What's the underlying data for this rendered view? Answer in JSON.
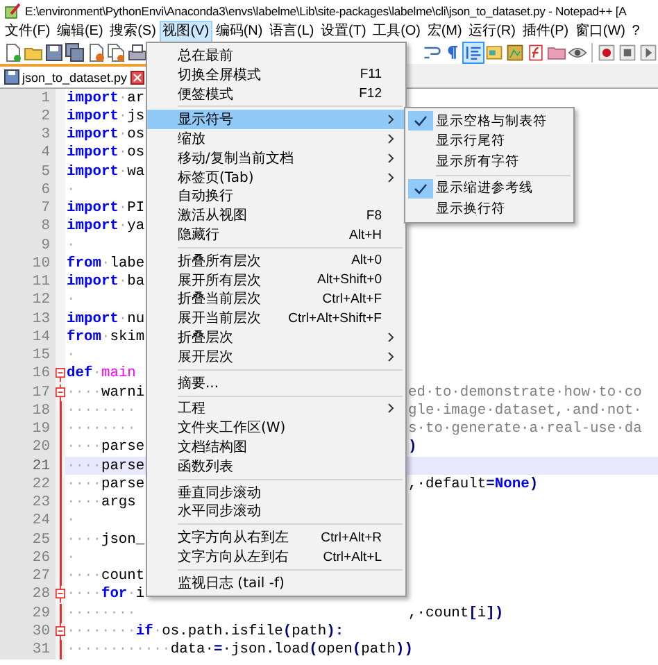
{
  "window": {
    "title": "E:\\environment\\PythonEnvi\\Anaconda3\\envs\\labelme\\Lib\\site-packages\\labelme\\cli\\json_to_dataset.py - Notepad++ [A"
  },
  "menubar": [
    {
      "label": "文件(F)",
      "selected": false
    },
    {
      "label": "编辑(E)",
      "selected": false
    },
    {
      "label": "搜索(S)",
      "selected": false
    },
    {
      "label": "视图(V)",
      "selected": true
    },
    {
      "label": "编码(N)",
      "selected": false
    },
    {
      "label": "语言(L)",
      "selected": false
    },
    {
      "label": "设置(T)",
      "selected": false
    },
    {
      "label": "工具(O)",
      "selected": false
    },
    {
      "label": "宏(M)",
      "selected": false
    },
    {
      "label": "运行(R)",
      "selected": false
    },
    {
      "label": "插件(P)",
      "selected": false
    },
    {
      "label": "窗口(W)",
      "selected": false
    },
    {
      "label": "?",
      "selected": false
    }
  ],
  "toolbar": {
    "left": [
      {
        "kind": "new"
      },
      {
        "kind": "open"
      },
      {
        "kind": "save"
      },
      {
        "kind": "save-all"
      },
      {
        "kind": "close"
      },
      {
        "kind": "close-all"
      },
      {
        "kind": "print"
      }
    ],
    "right": [
      {
        "kind": "wrap",
        "selected": false
      },
      {
        "kind": "pilcrow",
        "selected": false
      },
      {
        "kind": "indent",
        "selected": true
      },
      {
        "kind": "doc",
        "selected": false
      },
      {
        "kind": "map",
        "selected": false
      },
      {
        "kind": "func",
        "selected": false
      },
      {
        "kind": "folder",
        "selected": false
      },
      {
        "kind": "eye",
        "selected": false
      },
      {
        "kind": "sep",
        "selected": false
      },
      {
        "kind": "record",
        "selected": false
      },
      {
        "kind": "stop",
        "selected": false
      },
      {
        "kind": "play",
        "selected": false
      }
    ]
  },
  "tabs": [
    {
      "label": "json_to_dataset.py",
      "selected": true
    }
  ],
  "editor": {
    "lines": [
      {
        "number": "1",
        "fold_start": false,
        "in_fold": false,
        "highlighted": false,
        "left": [
          {
            "text": "import",
            "kind": "kw"
          },
          {
            "text": "·",
            "kind": "ws"
          },
          {
            "text": "ar",
            "kind": "tx"
          }
        ]
      },
      {
        "number": "2",
        "fold_start": false,
        "in_fold": false,
        "highlighted": false,
        "left": [
          {
            "text": "import",
            "kind": "kw"
          },
          {
            "text": "·",
            "kind": "ws"
          },
          {
            "text": "js",
            "kind": "tx"
          }
        ]
      },
      {
        "number": "3",
        "fold_start": false,
        "in_fold": false,
        "highlighted": false,
        "left": [
          {
            "text": "import",
            "kind": "kw"
          },
          {
            "text": "·",
            "kind": "ws"
          },
          {
            "text": "os",
            "kind": "tx"
          }
        ]
      },
      {
        "number": "4",
        "fold_start": false,
        "in_fold": false,
        "highlighted": false,
        "left": [
          {
            "text": "import",
            "kind": "kw"
          },
          {
            "text": "·",
            "kind": "ws"
          },
          {
            "text": "os",
            "kind": "tx"
          }
        ]
      },
      {
        "number": "5",
        "fold_start": false,
        "in_fold": false,
        "highlighted": false,
        "left": [
          {
            "text": "import",
            "kind": "kw"
          },
          {
            "text": "·",
            "kind": "ws"
          },
          {
            "text": "wa",
            "kind": "tx"
          }
        ]
      },
      {
        "number": "6",
        "fold_start": false,
        "in_fold": false,
        "highlighted": false,
        "left": [
          {
            "text": "·",
            "kind": "ws"
          }
        ]
      },
      {
        "number": "7",
        "fold_start": false,
        "in_fold": false,
        "highlighted": false,
        "left": [
          {
            "text": "import",
            "kind": "kw"
          },
          {
            "text": "·",
            "kind": "ws"
          },
          {
            "text": "PI",
            "kind": "tx"
          }
        ]
      },
      {
        "number": "8",
        "fold_start": false,
        "in_fold": false,
        "highlighted": false,
        "left": [
          {
            "text": "import",
            "kind": "kw"
          },
          {
            "text": "·",
            "kind": "ws"
          },
          {
            "text": "ya",
            "kind": "tx"
          }
        ]
      },
      {
        "number": "9",
        "fold_start": false,
        "in_fold": false,
        "highlighted": false,
        "left": [
          {
            "text": "·",
            "kind": "ws"
          }
        ]
      },
      {
        "number": "10",
        "fold_start": false,
        "in_fold": false,
        "highlighted": false,
        "left": [
          {
            "text": "from",
            "kind": "kw"
          },
          {
            "text": "·",
            "kind": "ws"
          },
          {
            "text": "labe",
            "kind": "tx"
          }
        ]
      },
      {
        "number": "11",
        "fold_start": false,
        "in_fold": false,
        "highlighted": false,
        "left": [
          {
            "text": "import",
            "kind": "kw"
          },
          {
            "text": "·",
            "kind": "ws"
          },
          {
            "text": "ba",
            "kind": "tx"
          }
        ]
      },
      {
        "number": "12",
        "fold_start": false,
        "in_fold": false,
        "highlighted": false,
        "left": [
          {
            "text": "·",
            "kind": "ws"
          }
        ]
      },
      {
        "number": "13",
        "fold_start": false,
        "in_fold": false,
        "highlighted": false,
        "left": [
          {
            "text": "import",
            "kind": "kw"
          },
          {
            "text": "·",
            "kind": "ws"
          },
          {
            "text": "nu",
            "kind": "tx"
          }
        ]
      },
      {
        "number": "14",
        "fold_start": false,
        "in_fold": false,
        "highlighted": false,
        "left": [
          {
            "text": "from",
            "kind": "kw"
          },
          {
            "text": "·",
            "kind": "ws"
          },
          {
            "text": "skim",
            "kind": "tx"
          }
        ]
      },
      {
        "number": "15",
        "fold_start": false,
        "in_fold": false,
        "highlighted": false,
        "left": [
          {
            "text": "·",
            "kind": "ws"
          }
        ]
      },
      {
        "number": "16",
        "fold_start": true,
        "in_fold": false,
        "highlighted": false,
        "left": [
          {
            "text": "def",
            "kind": "kw"
          },
          {
            "text": "·",
            "kind": "ws"
          },
          {
            "text": "main",
            "kind": "fn"
          }
        ]
      },
      {
        "number": "17",
        "fold_start": true,
        "in_fold": true,
        "highlighted": false,
        "left": [
          {
            "text": "····",
            "kind": "ws"
          },
          {
            "text": "warni",
            "kind": "tx"
          }
        ],
        "right": [
          {
            "text": "ed·to·demonstrate·how·to·co",
            "kind": "cm"
          }
        ]
      },
      {
        "number": "18",
        "fold_start": false,
        "in_fold": true,
        "highlighted": false,
        "left": [
          {
            "text": "········",
            "kind": "ws"
          }
        ],
        "right": [
          {
            "text": "gle·image·dataset,·and·not·",
            "kind": "cm"
          }
        ]
      },
      {
        "number": "19",
        "fold_start": false,
        "in_fold": true,
        "highlighted": false,
        "left": [
          {
            "text": "········",
            "kind": "ws"
          }
        ],
        "right": [
          {
            "text": "s·to·generate·a·real-use·da",
            "kind": "cm"
          }
        ]
      },
      {
        "number": "20",
        "fold_start": false,
        "in_fold": true,
        "highlighted": false,
        "left": [
          {
            "text": "····",
            "kind": "ws"
          },
          {
            "text": "parse",
            "kind": "tx"
          }
        ],
        "right": [
          {
            "text": ")",
            "kind": "op"
          }
        ]
      },
      {
        "number": "21",
        "fold_start": false,
        "in_fold": true,
        "highlighted": true,
        "left": [
          {
            "text": "····",
            "kind": "ws"
          },
          {
            "text": "parse",
            "kind": "tx"
          }
        ]
      },
      {
        "number": "22",
        "fold_start": false,
        "in_fold": true,
        "highlighted": false,
        "left": [
          {
            "text": "····",
            "kind": "ws"
          },
          {
            "text": "parse",
            "kind": "tx"
          }
        ],
        "right": [
          {
            "text": ",·default",
            "kind": "tx"
          },
          {
            "text": "=",
            "kind": "op"
          },
          {
            "text": "None",
            "kind": "kw"
          },
          {
            "text": ")",
            "kind": "op"
          }
        ]
      },
      {
        "number": "23",
        "fold_start": false,
        "in_fold": true,
        "highlighted": false,
        "left": [
          {
            "text": "····",
            "kind": "ws"
          },
          {
            "text": "args",
            "kind": "tx"
          }
        ]
      },
      {
        "number": "24",
        "fold_start": false,
        "in_fold": true,
        "highlighted": false,
        "left": [
          {
            "text": "·",
            "kind": "ws"
          }
        ]
      },
      {
        "number": "25",
        "fold_start": false,
        "in_fold": true,
        "highlighted": false,
        "left": [
          {
            "text": "····",
            "kind": "ws"
          },
          {
            "text": "json_",
            "kind": "tx"
          }
        ]
      },
      {
        "number": "26",
        "fold_start": false,
        "in_fold": true,
        "highlighted": false,
        "left": [
          {
            "text": "·",
            "kind": "ws"
          }
        ]
      },
      {
        "number": "27",
        "fold_start": false,
        "in_fold": true,
        "highlighted": false,
        "left": [
          {
            "text": "····",
            "kind": "ws"
          },
          {
            "text": "count",
            "kind": "tx"
          }
        ]
      },
      {
        "number": "28",
        "fold_start": true,
        "in_fold": true,
        "highlighted": false,
        "left": [
          {
            "text": "····",
            "kind": "ws"
          },
          {
            "text": "for",
            "kind": "kw"
          },
          {
            "text": "·",
            "kind": "ws"
          },
          {
            "text": "i",
            "kind": "tx"
          }
        ]
      },
      {
        "number": "29",
        "fold_start": false,
        "in_fold": true,
        "highlighted": false,
        "left": [
          {
            "text": "········",
            "kind": "ws"
          }
        ],
        "right": [
          {
            "text": ",·count",
            "kind": "tx"
          },
          {
            "text": "[",
            "kind": "op"
          },
          {
            "text": "i",
            "kind": "tx"
          },
          {
            "text": "])",
            "kind": "op"
          }
        ]
      },
      {
        "number": "30",
        "fold_start": true,
        "in_fold": true,
        "highlighted": false,
        "left": [
          {
            "text": "········",
            "kind": "ws"
          },
          {
            "text": "if",
            "kind": "kw"
          },
          {
            "text": "·",
            "kind": "ws"
          },
          {
            "text": "os.path.isfile",
            "kind": "tx"
          },
          {
            "text": "(",
            "kind": "op"
          },
          {
            "text": "path",
            "kind": "tx"
          },
          {
            "text": "):",
            "kind": "op"
          }
        ]
      },
      {
        "number": "31",
        "fold_start": false,
        "in_fold": true,
        "highlighted": false,
        "left": [
          {
            "text": "············",
            "kind": "ws"
          },
          {
            "text": "data·",
            "kind": "tx"
          },
          {
            "text": "=",
            "kind": "op"
          },
          {
            "text": "·json.load",
            "kind": "tx"
          },
          {
            "text": "(",
            "kind": "op"
          },
          {
            "text": "open",
            "kind": "tx"
          },
          {
            "text": "(",
            "kind": "op"
          },
          {
            "text": "path",
            "kind": "tx"
          },
          {
            "text": "))",
            "kind": "op"
          }
        ]
      }
    ]
  },
  "view_menu": {
    "items": [
      {
        "kind": "item",
        "label": "总在最前",
        "selected": false
      },
      {
        "kind": "item",
        "label": "切换全屏模式",
        "shortcut": "F11",
        "selected": false
      },
      {
        "kind": "item",
        "label": "便签模式",
        "shortcut": "F12",
        "selected": false
      },
      {
        "kind": "separator"
      },
      {
        "kind": "submenu",
        "label": "显示符号",
        "selected": true
      },
      {
        "kind": "submenu",
        "label": "缩放",
        "selected": false
      },
      {
        "kind": "submenu",
        "label": "移动/复制当前文档",
        "selected": false
      },
      {
        "kind": "submenu",
        "label": "标签页(Tab)",
        "selected": false
      },
      {
        "kind": "item",
        "label": "自动换行",
        "selected": false
      },
      {
        "kind": "item",
        "label": "激活从视图",
        "shortcut": "F8",
        "selected": false
      },
      {
        "kind": "item",
        "label": "隐藏行",
        "shortcut": "Alt+H",
        "selected": false
      },
      {
        "kind": "separator"
      },
      {
        "kind": "item",
        "label": "折叠所有层次",
        "shortcut": "Alt+0",
        "selected": false
      },
      {
        "kind": "item",
        "label": "展开所有层次",
        "shortcut": "Alt+Shift+0",
        "selected": false
      },
      {
        "kind": "item",
        "label": "折叠当前层次",
        "shortcut": "Ctrl+Alt+F",
        "selected": false
      },
      {
        "kind": "item",
        "label": "展开当前层次",
        "shortcut": "Ctrl+Alt+Shift+F",
        "selected": false
      },
      {
        "kind": "submenu",
        "label": "折叠层次",
        "selected": false
      },
      {
        "kind": "submenu",
        "label": "展开层次",
        "selected": false
      },
      {
        "kind": "separator"
      },
      {
        "kind": "item",
        "label": "摘要...",
        "selected": false
      },
      {
        "kind": "separator"
      },
      {
        "kind": "submenu",
        "label": "工程",
        "selected": false
      },
      {
        "kind": "item",
        "label": "文件夹工作区(W)",
        "selected": false
      },
      {
        "kind": "item",
        "label": "文档结构图",
        "selected": false
      },
      {
        "kind": "item",
        "label": "函数列表",
        "selected": false
      },
      {
        "kind": "separator"
      },
      {
        "kind": "item",
        "label": "垂直同步滚动",
        "selected": false
      },
      {
        "kind": "item",
        "label": "水平同步滚动",
        "selected": false
      },
      {
        "kind": "separator"
      },
      {
        "kind": "item",
        "label": "文字方向从右到左",
        "shortcut": "Ctrl+Alt+R",
        "selected": false
      },
      {
        "kind": "item",
        "label": "文字方向从左到右",
        "shortcut": "Ctrl+Alt+L",
        "selected": false
      },
      {
        "kind": "separator"
      },
      {
        "kind": "item",
        "label": "监视日志 (tail -f)",
        "selected": false
      }
    ]
  },
  "symbols_submenu": {
    "items": [
      {
        "kind": "item",
        "label": "显示空格与制表符",
        "checked": true
      },
      {
        "kind": "item",
        "label": "显示行尾符",
        "checked": false
      },
      {
        "kind": "item",
        "label": "显示所有字符",
        "checked": false
      },
      {
        "kind": "separator"
      },
      {
        "kind": "item",
        "label": "显示缩进参考线",
        "checked": true
      },
      {
        "kind": "item",
        "label": "显示换行符",
        "checked": false
      }
    ]
  }
}
